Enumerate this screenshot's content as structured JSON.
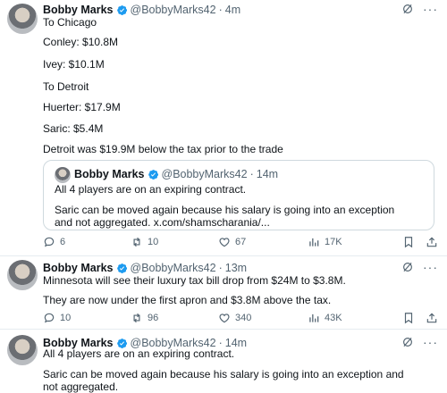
{
  "tweet1": {
    "name": "Bobby Marks",
    "handle": "@BobbyMarks42",
    "time": "4m",
    "lines": [
      "To Chicago",
      "Conley: $10.8M",
      "Ivey: $10.1M",
      "To Detroit",
      "Huerter: $17.9M",
      "Saric: $5.4M",
      "Detroit was $19.9M below the tax prior to the trade"
    ],
    "quote": {
      "name": "Bobby Marks",
      "handle": "@BobbyMarks42",
      "time": "14m",
      "lines": [
        "All 4 players are on an expiring contract.",
        "Saric can be moved again because his salary is going into an exception",
        "and not aggregated. x.com/shamscharania/..."
      ]
    },
    "actions": {
      "replies": "6",
      "reposts": "10",
      "likes": "67",
      "views": "17K"
    }
  },
  "tweet2": {
    "name": "Bobby Marks",
    "handle": "@BobbyMarks42",
    "time": "13m",
    "lines": [
      "Minnesota will see their luxury tax bill drop from $24M to $3.8M.",
      "They are now under the first apron and $3.8M above the tax."
    ],
    "actions": {
      "replies": "10",
      "reposts": "96",
      "likes": "340",
      "views": "43K"
    }
  },
  "tweet3": {
    "name": "Bobby Marks",
    "handle": "@BobbyMarks42",
    "time": "14m",
    "lines": [
      "All 4 players are on an expiring contract.",
      "Saric can be moved again because his salary is going into an exception and",
      "not aggregated."
    ]
  },
  "ui": {
    "separator": "·",
    "more": "···",
    "icons": [
      "verified-badge-icon",
      "grok-icon",
      "reply-icon",
      "repost-icon",
      "like-icon",
      "views-icon",
      "bookmark-icon",
      "share-icon"
    ],
    "colors": {
      "verified": "#1d9bf0",
      "muted": "#536471",
      "border": "#cfd9de"
    }
  }
}
